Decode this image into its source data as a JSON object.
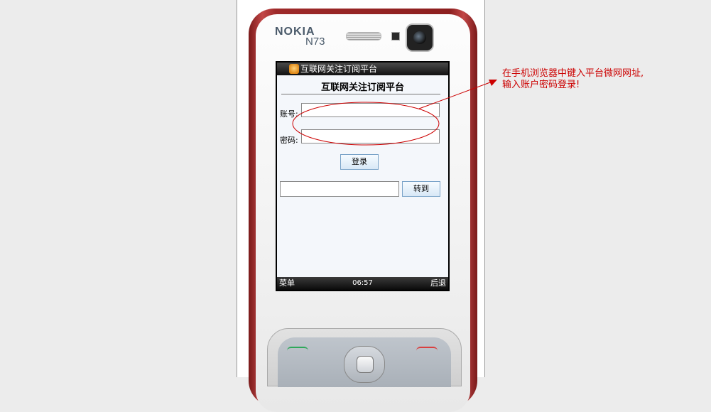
{
  "phone": {
    "brand": "NOKIA",
    "model": "N73"
  },
  "browser": {
    "tab_title": "互联网关注订阅平台",
    "page_heading": "互联网关注订阅平台",
    "account_label": "账号:",
    "password_label": "密码:",
    "account_value": "",
    "password_value": "",
    "login_button": "登录",
    "url_value": "",
    "goto_button": "转到"
  },
  "softkeys": {
    "left": "菜单",
    "time": "06:57",
    "right": "后退"
  },
  "annotation": {
    "line1": "在手机浏览器中键入平台微网网址,",
    "line2": "输入账户密码登录!"
  },
  "colors": {
    "annotation": "#cc0000",
    "phone_body": "#9e2a2a",
    "button_border": "#7aa3c8"
  }
}
